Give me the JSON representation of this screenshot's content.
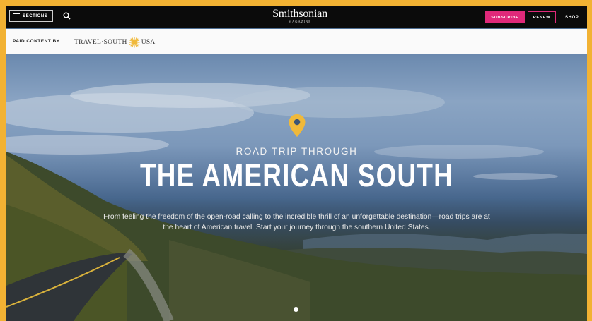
{
  "nav": {
    "sections_label": "SECTIONS",
    "logo_main": "Smithsonian",
    "logo_sub": "MAGAZINE",
    "subscribe_label": "SUBSCRIBE",
    "renew_label": "RENEW",
    "shop_label": "SHOP"
  },
  "sponsor_strip": {
    "label": "PAID CONTENT BY",
    "sponsor_left": "TRAVEL·SOUTH",
    "sponsor_right": "USA"
  },
  "hero": {
    "kicker": "ROAD TRIP THROUGH",
    "headline": "THE AMERICAN SOUTH",
    "intro": "From feeling the freedom of the open-road calling to the incredible thrill of an unforgettable destination—road trips are at the heart of American travel. Start your journey through the southern United States."
  },
  "colors": {
    "frame": "#f2b233",
    "accent_pink": "#e0297a",
    "pin": "#f0b93a",
    "nav_bg": "#0b0b0b"
  },
  "icons": [
    "menu-icon",
    "search-icon",
    "sun-icon",
    "location-pin-icon"
  ]
}
